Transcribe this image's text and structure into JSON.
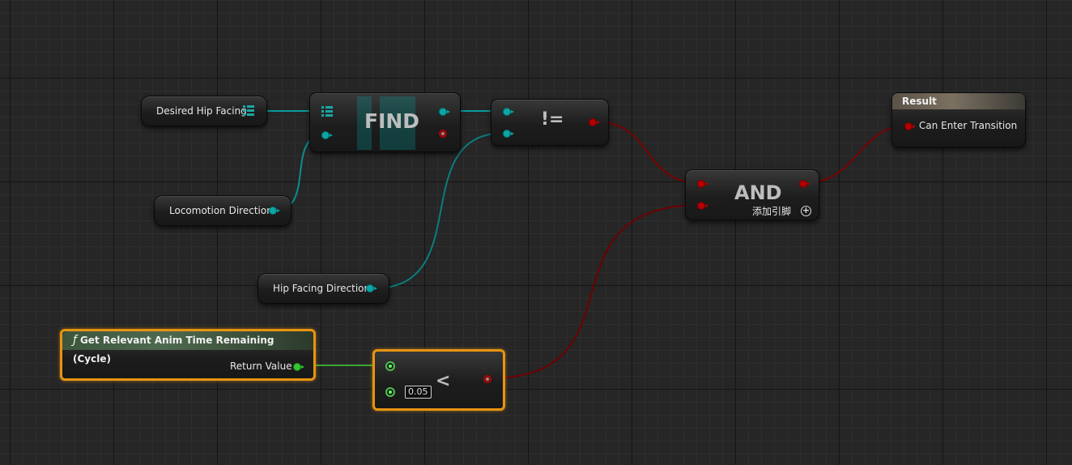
{
  "nodes": {
    "desired_hip_facing": {
      "label": "Desired Hip Facing"
    },
    "find": {
      "title": "FIND"
    },
    "not_equal": {
      "title": "!="
    },
    "locomotion_direction": {
      "label": "Locomotion Direction"
    },
    "hip_facing_direction": {
      "label": "Hip Facing Direction"
    },
    "and": {
      "title": "AND",
      "add_pin_label": "添加引脚",
      "add_pin_icon": "plus-circle-icon"
    },
    "result": {
      "header": "Result",
      "pin_label": "Can Enter Transition"
    },
    "get_relevant_anim_time": {
      "function_icon": "ƒ",
      "header": "Get Relevant Anim Time Remaining (Cycle)",
      "pin_label": "Return Value"
    },
    "less_than": {
      "title": "<",
      "literal_value": "0.05"
    }
  },
  "colors": {
    "background": "#262626",
    "grid_major": "#151515",
    "grid_minor": "#2e2e2e",
    "struct_pin": "#0aa6a6",
    "bool_pin": "#b40000",
    "float_pin": "#32c832",
    "selection": "#e89410",
    "result_header": "#6f6455",
    "function_header": "#3d553d"
  }
}
